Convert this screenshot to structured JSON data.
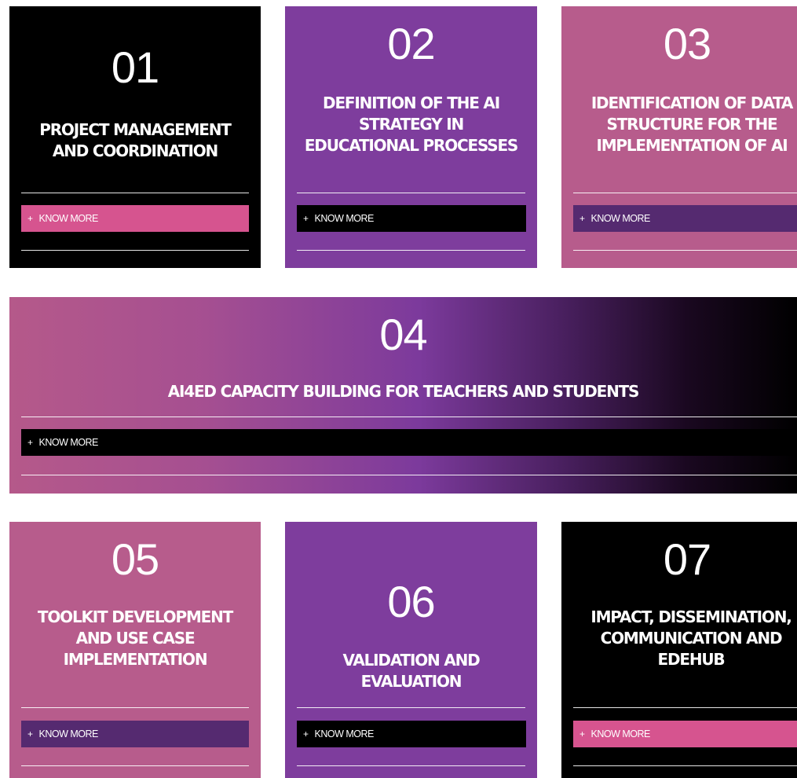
{
  "cards": [
    {
      "number": "01",
      "title": "PROJECT MANAGEMENT AND COORDINATION",
      "button": "KNOW MORE",
      "button_icon": "plus-icon"
    },
    {
      "number": "02",
      "title": "DEFINITION OF THE AI STRATEGY IN EDUCATIONAL PROCESSES",
      "button": "KNOW MORE",
      "button_icon": "plus-icon"
    },
    {
      "number": "03",
      "title": "IDENTIFICATION OF DATA STRUCTURE FOR THE IMPLEMENTATION OF AI",
      "button": "KNOW MORE",
      "button_icon": "plus-icon"
    },
    {
      "number": "04",
      "title": "AI4ED CAPACITY BUILDING FOR TEACHERS AND STUDENTS",
      "button": "KNOW MORE",
      "button_icon": "plus-icon"
    },
    {
      "number": "05",
      "title": "TOOLKIT DEVELOPMENT AND USE CASE IMPLEMENTATION",
      "button": "KNOW MORE",
      "button_icon": "plus-icon"
    },
    {
      "number": "06",
      "title": "VALIDATION AND EVALUATION",
      "button": "KNOW MORE",
      "button_icon": "plus-icon"
    },
    {
      "number": "07",
      "title": "IMPACT, DISSEMINATION, COMMUNICATION AND EDEHUB",
      "button": "KNOW MORE",
      "button_icon": "plus-icon"
    }
  ],
  "plus_symbol": "+",
  "colors": {
    "black": "#000000",
    "purple": "#7e3d9d",
    "mauve": "#b75c8c",
    "pink_button": "#d6548f",
    "dark_purple_button": "#552a70"
  }
}
